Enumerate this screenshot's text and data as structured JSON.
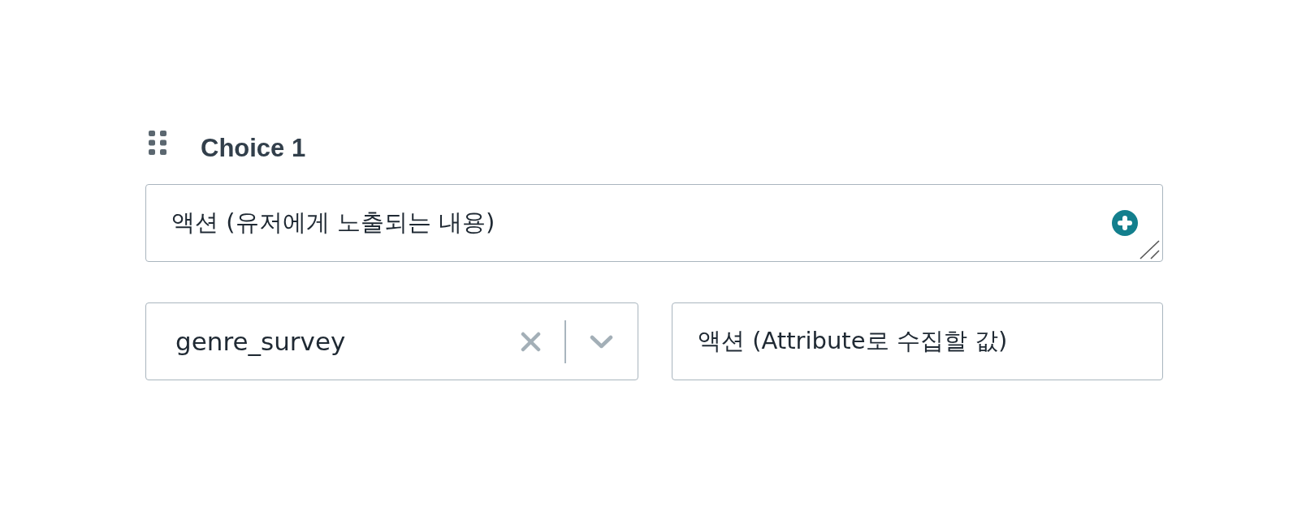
{
  "choice": {
    "title": "Choice 1",
    "message_field": {
      "value": "액션 (유저에게 노출되는 내용)"
    },
    "attribute_select": {
      "value": "genre_survey"
    },
    "value_field": {
      "value": "액션 (Attribute로 수집할 값)"
    }
  }
}
